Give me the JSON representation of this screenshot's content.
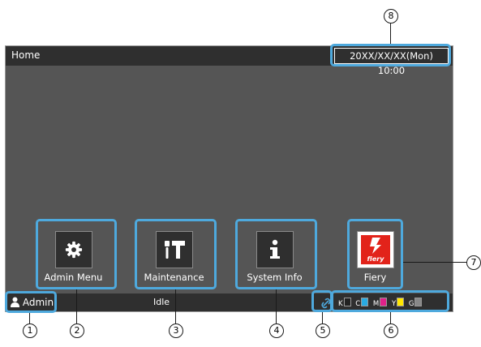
{
  "title_bar": {
    "title": "Home",
    "datetime": "20XX/XX/XX(Mon) 10:00"
  },
  "tiles": {
    "admin_menu": {
      "label": "Admin Menu",
      "icon": "gear-icon"
    },
    "maintenance": {
      "label": "Maintenance",
      "icon": "tools-icon"
    },
    "system_info": {
      "label": "System Info",
      "icon": "info-icon"
    },
    "fiery": {
      "label": "Fiery",
      "icon": "fiery-logo",
      "logo_text": "fiery"
    }
  },
  "status_bar": {
    "user": "Admin",
    "status": "Idle",
    "inks": {
      "k": "K",
      "c": "C",
      "m": "M",
      "y": "Y",
      "g": "G"
    }
  },
  "callouts": {
    "c1": "1",
    "c2": "2",
    "c3": "3",
    "c4": "4",
    "c5": "5",
    "c6": "6",
    "c7": "7",
    "c8": "8"
  },
  "colors": {
    "highlight": "#4ea9dd",
    "screen_bg": "#555555",
    "bar_bg": "#2f2f2f",
    "fiery_red": "#e2231a",
    "cyan": "#29abe2",
    "magenta": "#e0218a",
    "yellow": "#ffe600"
  }
}
